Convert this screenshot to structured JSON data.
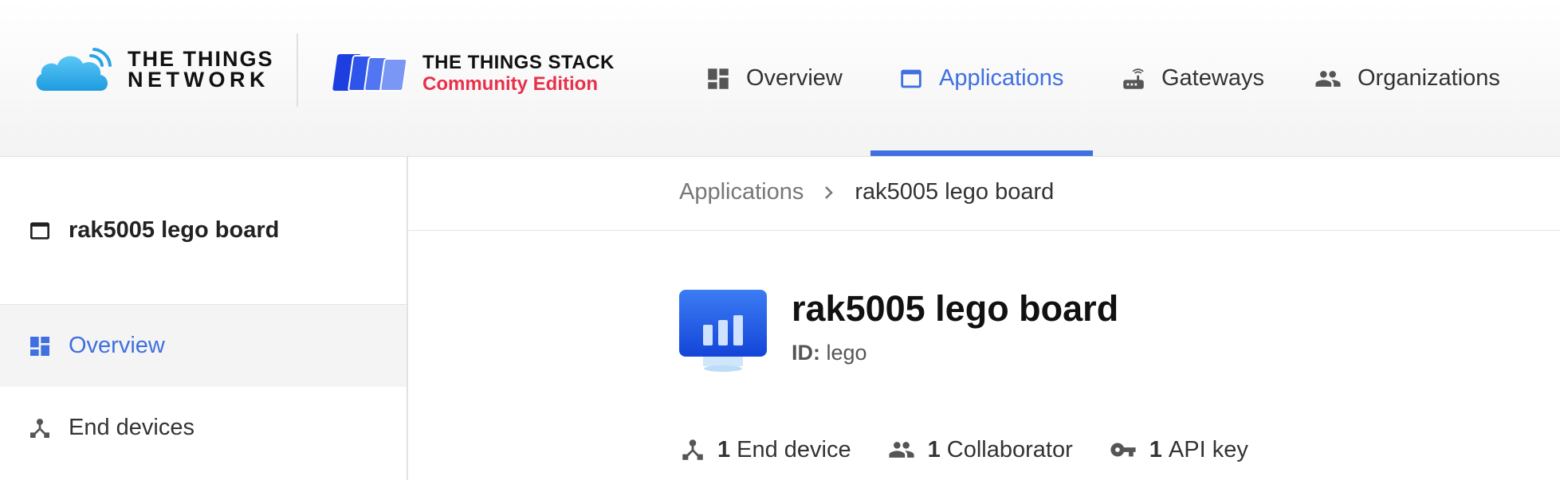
{
  "brand": {
    "ttn_line1": "THE THINGS",
    "ttn_line2": "NETWORK",
    "tts_line1": "THE THINGS STACK",
    "tts_line2": "Community Edition",
    "accent_color": "#3f6fe0",
    "edition_color": "#e8304a"
  },
  "nav": {
    "items": [
      {
        "label": "Overview",
        "icon": "dashboard-icon"
      },
      {
        "label": "Applications",
        "icon": "application-icon",
        "active": true
      },
      {
        "label": "Gateways",
        "icon": "router-icon"
      },
      {
        "label": "Organizations",
        "icon": "people-icon"
      }
    ]
  },
  "sidebar": {
    "title": "rak5005 lego board",
    "items": [
      {
        "label": "Overview",
        "icon": "dashboard-icon",
        "active": true
      },
      {
        "label": "End devices",
        "icon": "device-hub-icon"
      }
    ]
  },
  "breadcrumb": {
    "parent": "Applications",
    "current": "rak5005 lego board"
  },
  "app": {
    "name": "rak5005 lego board",
    "id_label": "ID:",
    "id_value": "lego"
  },
  "stats": [
    {
      "count": "1",
      "label": "End device",
      "icon": "device-hub-icon"
    },
    {
      "count": "1",
      "label": "Collaborator",
      "icon": "people-icon"
    },
    {
      "count": "1",
      "label": "API key",
      "icon": "key-icon"
    }
  ]
}
